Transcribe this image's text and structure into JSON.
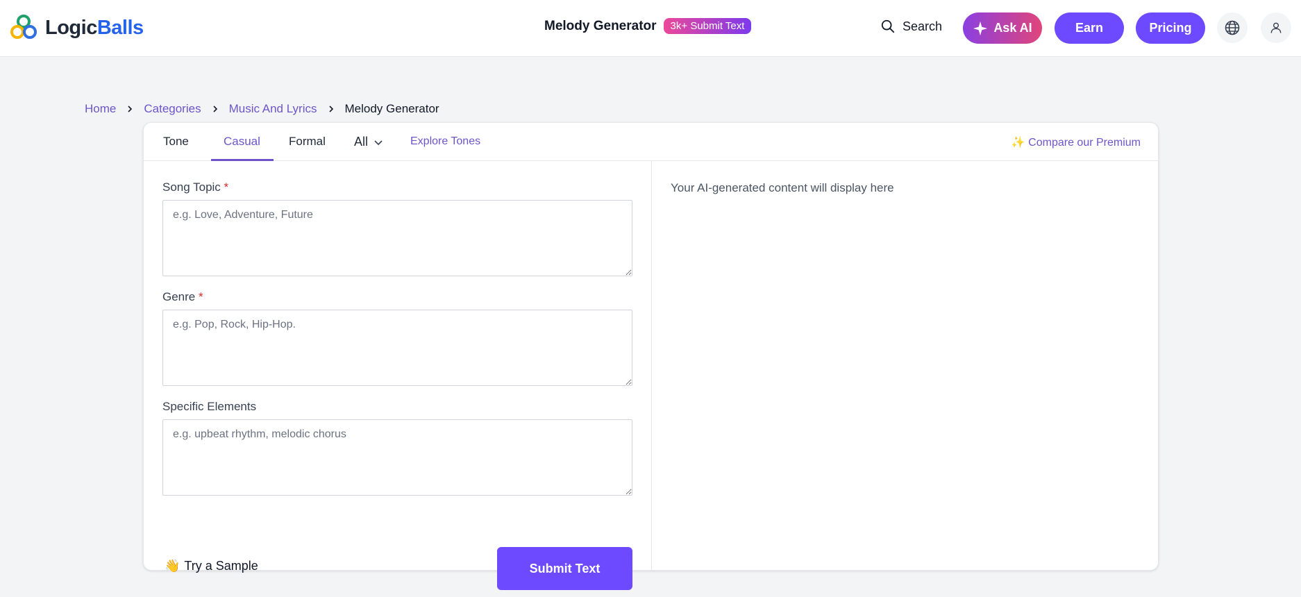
{
  "header": {
    "logo_part1": "Logic",
    "logo_part2": "Balls",
    "tool_name": "Melody Generator",
    "badge": "3k+ Submit Text",
    "search_label": "Search",
    "ask_ai_label": "Ask AI",
    "earn_label": "Earn",
    "pricing_label": "Pricing",
    "icons": [
      "search-icon",
      "sparkle-icon",
      "globe-icon",
      "user-icon"
    ]
  },
  "breadcrumb": {
    "items": [
      "Home",
      "Categories",
      "Music And Lyrics"
    ],
    "current": "Melody Generator"
  },
  "tabs": {
    "tone": "Tone",
    "casual": "Casual",
    "formal": "Formal",
    "all": "All",
    "explore": "Explore Tones",
    "compare": "✨ Compare our Premium",
    "active": "Casual"
  },
  "form": {
    "topic_label": "Song Topic",
    "topic_placeholder": "e.g. Love, Adventure, Future",
    "genre_label": "Genre",
    "genre_placeholder": "e.g. Pop, Rock, Hip-Hop.",
    "elements_label": "Specific Elements",
    "elements_placeholder": "e.g. upbeat rhythm, melodic chorus",
    "required_mark": "*",
    "sample_emoji": "👋",
    "sample_label": "Try a Sample",
    "submit_label": "Submit Text"
  },
  "output": {
    "placeholder": "Your AI-generated content will display here"
  },
  "colors": {
    "accent": "#6d4aff",
    "link": "#6d55c9",
    "required": "#dc2626"
  }
}
